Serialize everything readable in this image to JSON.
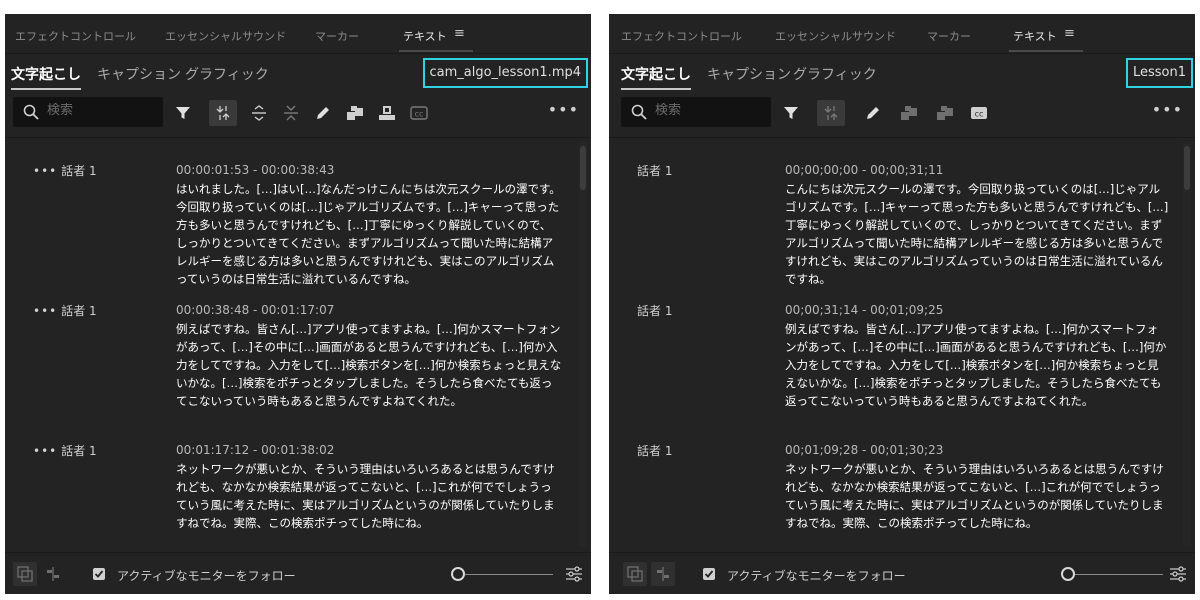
{
  "panels": [
    {
      "top_tabs": [
        "エフェクトコントロール",
        "エッセンシャルサウンド",
        "マーカー",
        "テキスト"
      ],
      "hamburger": "≡",
      "sub_tabs": [
        "文字起こし",
        "キャプション",
        "グラフィック"
      ],
      "file_label": "cam_algo_lesson1.mp4",
      "search_placeholder": "検索",
      "more": "•••",
      "toolbar_icons": [
        "filter-icon",
        "merge-icon",
        "split-icon",
        "collapse-icon",
        "edit-icon",
        "speaker-icon",
        "export-icon",
        "cc-icon"
      ],
      "entries": [
        {
          "speaker": "話者 1",
          "time": "00:00:01:53 - 00:00:38:43",
          "text": "はいれました。[…]はい[…]なんだっけこんにちは次元スクールの澤です。今回取り扱っていくのは[…]じゃアルゴリズムです。[…]キャーって思った方も多いと思うんですけれども、[…]丁寧にゆっくり解説していくので、しっかりとついてきてください。まずアルゴリズムって聞いた時に結構アレルギーを感じる方は多いと思うんですけれども、実はこのアルゴリズムっていうのは日常生活に溢れているんですね。"
        },
        {
          "speaker": "話者 1",
          "time": "00:00:38:48 - 00:01:17:07",
          "text": "例えばですね。皆さん[…]アプリ使ってますよね。[…]何かスマートフォンがあって、[…]その中に[…]画面があると思うんですけれども、[…]何か入力をしてですね。入力をして[…]検索ボタンを[…]何か検索ちょっと見えないかな。[…]検索をポチっとタップしました。そうしたら食べたても返ってこないっていう時もあると思うんですよねてくれた。"
        },
        {
          "speaker": "話者 1",
          "time": "00:01:17:12 - 00:01:38:02",
          "text": "ネットワークが悪いとか、そういう理由はいろいろあるとは思うんですけれども、なかなか検索結果が返ってこないと、[…]これが何ででしょうっていう風に考えた時に、実はアルゴリズムというのが関係していたりしますねでね。実際、この検索ポチってした時にね。"
        }
      ],
      "footer": {
        "follow_label": "アクティブなモニターをフォロー"
      }
    },
    {
      "top_tabs": [
        "エフェクトコントロール",
        "エッセンシャルサウンド",
        "マーカー",
        "テキスト"
      ],
      "hamburger": "≡",
      "sub_tabs": [
        "文字起こし",
        "キャプション",
        "グラフィック"
      ],
      "file_label": "Lesson1",
      "search_placeholder": "検索",
      "more": "•••",
      "toolbar_icons": [
        "filter-icon",
        "merge-icon",
        "edit-icon",
        "speaker-icon",
        "speaker-icon",
        "cc-icon"
      ],
      "entries": [
        {
          "speaker": "話者 1",
          "time": "00;00;00;00 - 00;00;31;11",
          "text": "こんにちは次元スクールの澤です。今回取り扱っていくのは[…]じゃアルゴリズムです。[…]キャーって思った方も多いと思うんですけれども、[…]丁寧にゆっくり解説していくので、しっかりとついてきてください。まずアルゴリズムって聞いた時に結構アレルギーを感じる方は多いと思うんですけれども、実はこのアルゴリズムっていうのは日常生活に溢れているんですね。"
        },
        {
          "speaker": "話者 1",
          "time": "00;00;31;14 - 00;01;09;25",
          "text": "例えばですね。皆さん[…]アプリ使ってますよね。[…]何かスマートフォンがあって、[…]その中に[…]画面があると思うんですけれども、[…]何か入力をしてですね。入力をして[…]検索ボタンを[…]何か検索ちょっと見えないかな。[…]検索をポチっとタップしました。そうしたら食べたても返ってこないっていう時もあると思うんですよねてくれた。"
        },
        {
          "speaker": "話者 1",
          "time": "00;01;09;28 - 00;01;30;23",
          "text": "ネットワークが悪いとか、そういう理由はいろいろあるとは思うんですけれども、なかなか検索結果が返ってこないと、[…]これが何ででしょうっていう風に考えた時に、実はアルゴリズムというのが関係していたりしますねでね。実際、この検索ポチってした時にね。"
        }
      ],
      "footer": {
        "follow_label": "アクティブなモニターをフォロー"
      }
    }
  ],
  "colors": {
    "panel_bg": "#232323",
    "highlight": "#2fd3e3",
    "text": "#ffffff"
  }
}
